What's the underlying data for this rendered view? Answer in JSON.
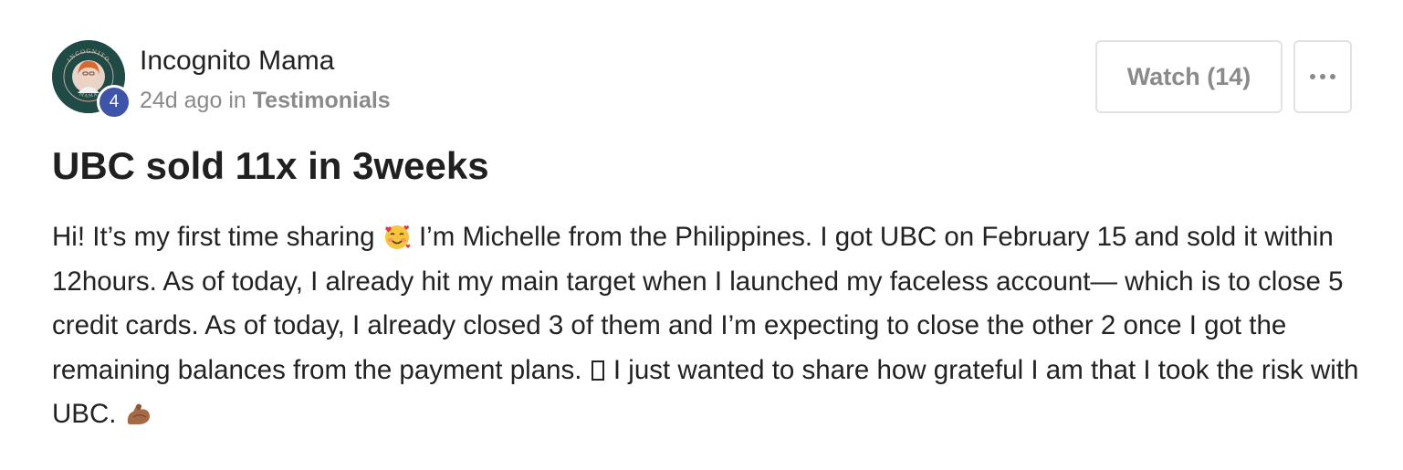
{
  "author": {
    "name": "Incognito Mama",
    "level": "4",
    "avatar_icon": "incognito-mama-logo-icon",
    "avatar_ring_text": "INCOGNITO MAMA",
    "avatar_color": "#1f4a46"
  },
  "meta": {
    "time": "24d ago",
    "in_word": "in",
    "category": "Testimonials"
  },
  "actions": {
    "watch_label": "Watch (14)",
    "more_icon": "ellipsis-icon"
  },
  "post": {
    "title": "UBC sold 11x in 3weeks",
    "body_part1": "Hi! It’s my first time sharing",
    "emoji1": "smiling-face-with-hearts-emoji",
    "body_part2": "I’m Michelle from the Philippines. I got UBC on February 15 and sold it within 12hours. As of today, I already hit my main target when I launched my faceless account— which is to close 5 credit cards. As of today, I already closed 3 of them and I’m expecting to close the other 2 once I got the remaining balances from the payment plans.",
    "glyph": "missing-glyph-box",
    "body_part3": "I just wanted to share how grateful I am that I took the risk with UBC.",
    "emoji2": "flexed-biceps-emoji"
  },
  "colors": {
    "badge": "#3d54a8",
    "muted_text": "#8a8a8a",
    "border": "#e2e2e2"
  }
}
